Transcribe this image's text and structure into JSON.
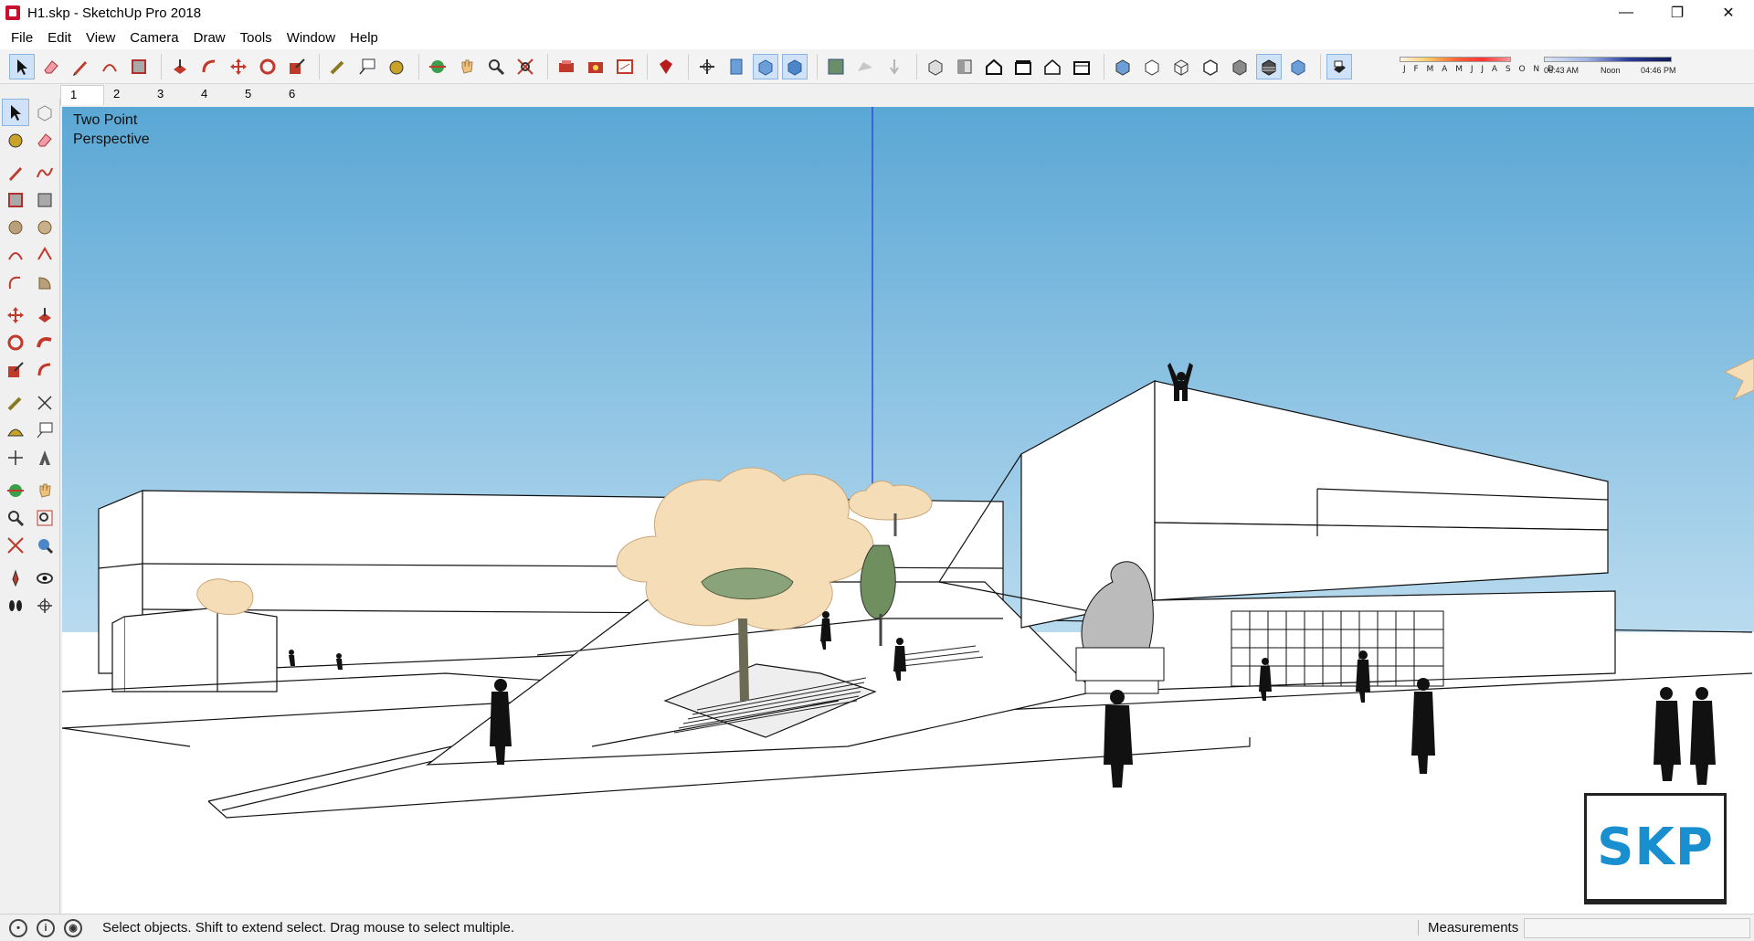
{
  "window": {
    "title": "H1.skp - SketchUp Pro 2018",
    "controls": {
      "minimize": "—",
      "maximize": "❐",
      "close": "✕"
    }
  },
  "menu": {
    "items": [
      "File",
      "Edit",
      "View",
      "Camera",
      "Draw",
      "Tools",
      "Window",
      "Help"
    ]
  },
  "toolbar": {
    "shadow": {
      "months": "J F M A M J J A S O N D",
      "time_start": "06:43 AM",
      "time_noon": "Noon",
      "time_end": "04:46 PM"
    }
  },
  "scenes": {
    "tabs": [
      "1",
      "2",
      "3",
      "4",
      "5",
      "6"
    ],
    "active_index": 0
  },
  "viewport": {
    "camera_label_line1": "Two Point",
    "camera_label_line2": "Perspective",
    "sky_top": "#5aa7d5",
    "sky_bottom": "#b9dbef"
  },
  "logo": {
    "text": "SKP"
  },
  "status": {
    "hint": "Select objects. Shift to extend select. Drag mouse to select multiple.",
    "measurements_label": "Measurements",
    "measurements_value": ""
  }
}
